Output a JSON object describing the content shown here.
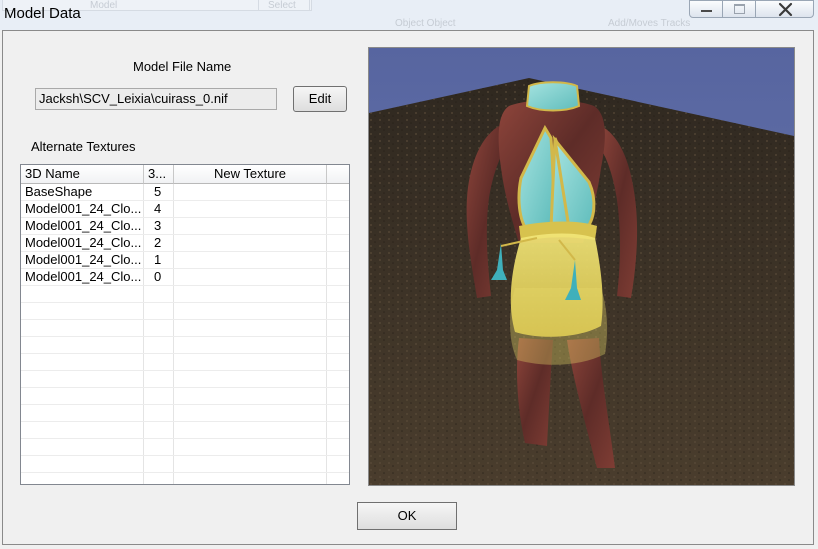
{
  "window": {
    "title": "Model Data",
    "background_labels": [
      "Model",
      "Select",
      "Object Object",
      "Add/Moves Tracks"
    ]
  },
  "model_file": {
    "heading": "Model File Name",
    "path": "Jacksh\\SCV_Leixia\\cuirass_0.nif",
    "edit_label": "Edit"
  },
  "alternate_textures": {
    "heading": "Alternate Textures",
    "columns": [
      "3D Name",
      "3...",
      "New Texture"
    ],
    "rows": [
      {
        "name": "BaseShape",
        "index": "5",
        "texture": ""
      },
      {
        "name": "Model001_24_Clo...",
        "index": "4",
        "texture": ""
      },
      {
        "name": "Model001_24_Clo...",
        "index": "3",
        "texture": ""
      },
      {
        "name": "Model001_24_Clo...",
        "index": "2",
        "texture": ""
      },
      {
        "name": "Model001_24_Clo...",
        "index": "1",
        "texture": ""
      },
      {
        "name": "Model001_24_Clo...",
        "index": "0",
        "texture": ""
      }
    ]
  },
  "ok_label": "OK",
  "colors": {
    "sky": "#5f6ea6",
    "ground": "#3a3023",
    "cloth_cyan": "#7fd1cf",
    "skirt_yellow": "#e7d85a",
    "skin_red": "#7b3a33"
  }
}
